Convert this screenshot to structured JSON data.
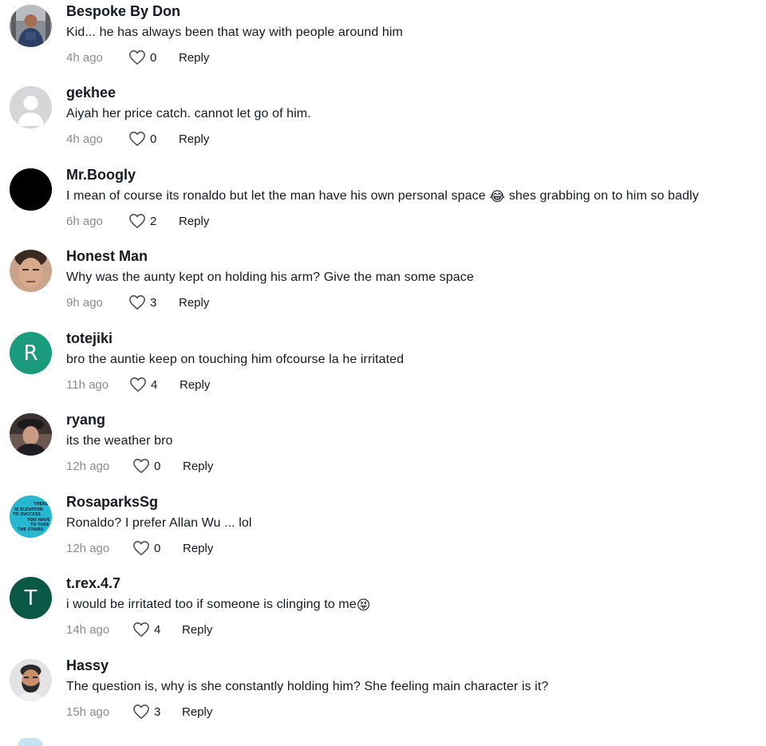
{
  "comments": [
    {
      "username": "Bespoke By Don",
      "text": "Kid... he has always been that way with people around him",
      "time": "4h ago",
      "likes": "0",
      "reply": "Reply",
      "avatar": "photo-man-gym"
    },
    {
      "username": "gekhee",
      "text": "Aiyah her price catch. cannot let go of him.",
      "time": "4h ago",
      "likes": "0",
      "reply": "Reply",
      "avatar": "default-user-icon"
    },
    {
      "username": "Mr.Boogly",
      "text": "I mean of course its ronaldo but let the man have his own personal space",
      "emoji": "😂",
      "text_after": "shes grabbing on to him so badly",
      "time": "6h ago",
      "likes": "2",
      "reply": "Reply",
      "avatar": "black-circle"
    },
    {
      "username": "Honest Man",
      "text": "Why was the aunty kept on holding his arm? Give the man some space",
      "time": "9h ago",
      "likes": "3",
      "reply": "Reply",
      "avatar": "photo-face"
    },
    {
      "username": "totejiki",
      "text": "bro the auntie keep on touching him ofcourse la he irritated",
      "time": "11h ago",
      "likes": "4",
      "reply": "Reply",
      "avatar_initial": "R",
      "avatar_color": "#1a9b7e"
    },
    {
      "username": "ryang",
      "text": "its the weather bro",
      "time": "12h ago",
      "likes": "0",
      "reply": "Reply",
      "avatar": "photo-person-hat"
    },
    {
      "username": "RosaparksSg",
      "text": "Ronaldo? I prefer Allan Wu ... lol",
      "time": "12h ago",
      "likes": "0",
      "reply": "Reply",
      "avatar": "photo-cyan-sign",
      "avatar_lettering": "THERE IS ELEVATOR TO SUCCESS YOU HAVE TO TAKE THE STAIRS"
    },
    {
      "username": "t.rex.4.7",
      "text": "i would be irritated too if someone is clinging to me",
      "emoji": "😝",
      "time": "14h ago",
      "likes": "4",
      "reply": "Reply",
      "avatar_initial": "T",
      "avatar_color": "#0b5846"
    },
    {
      "username": "Hassy",
      "text": "The question is, why is she constantly holding him? She feeling main character is it?",
      "time": "15h ago",
      "likes": "3",
      "reply": "Reply",
      "avatar": "cartoon-man-beard"
    }
  ]
}
